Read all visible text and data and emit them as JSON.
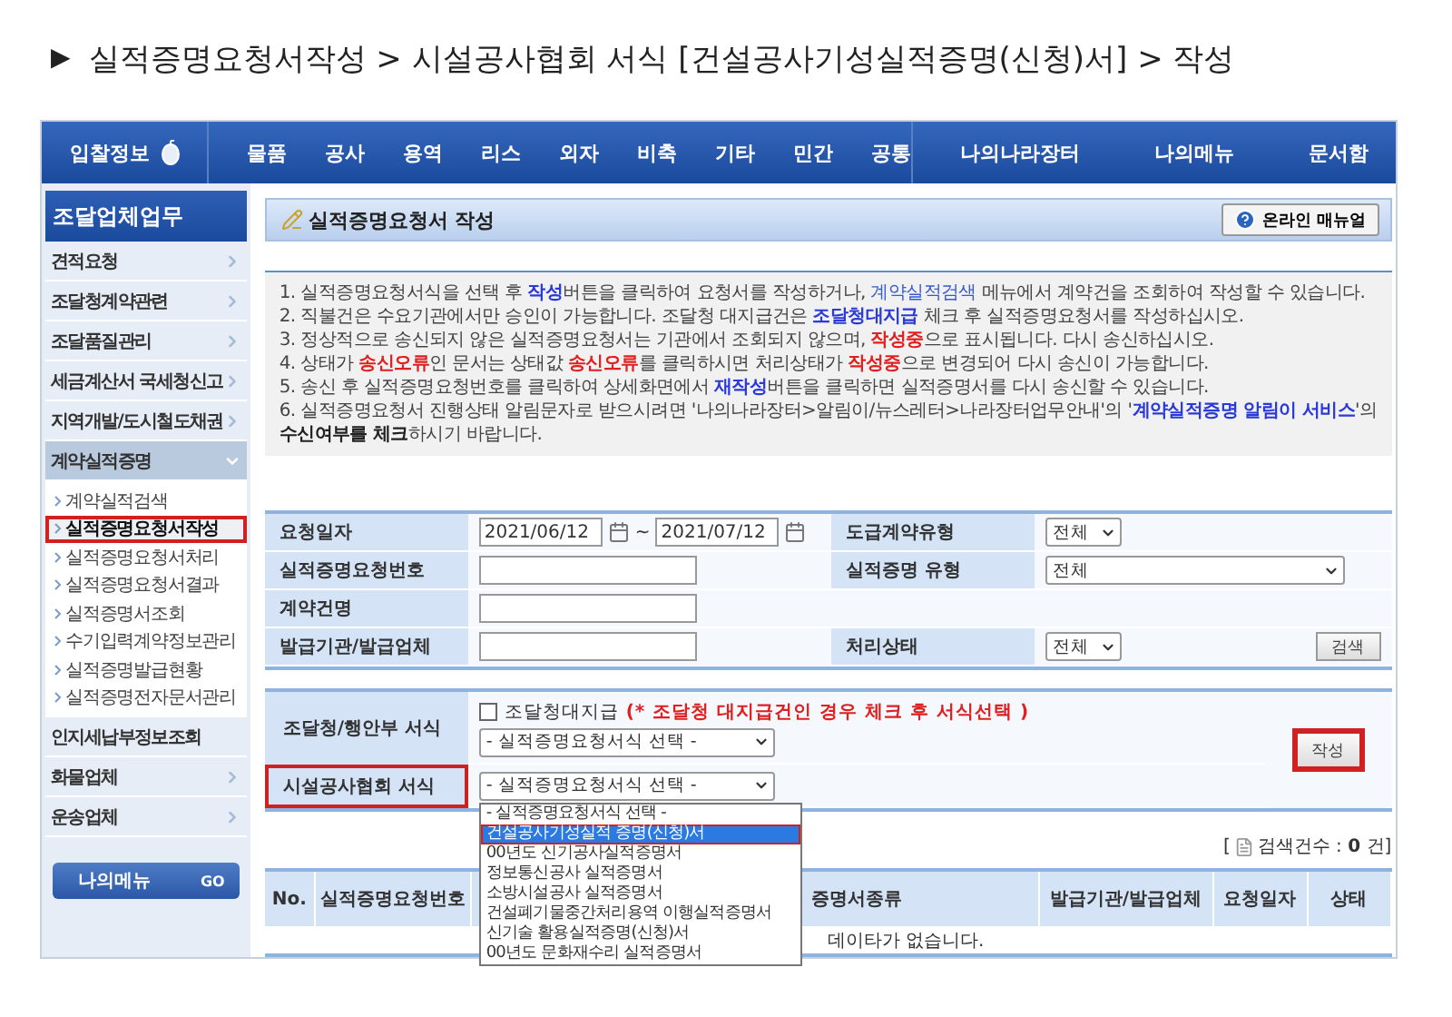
{
  "page_title": {
    "marker": "▶",
    "text": "실적증명요청서작성 > 시설공사협회 서식  [건설공사기성실적증명(신청)서] > 작성"
  },
  "nav": {
    "home": "입찰정보",
    "items": [
      "물품",
      "공사",
      "용역",
      "리스",
      "외자",
      "비축",
      "기타",
      "민간",
      "공통"
    ],
    "right_items": [
      "나의나라장터",
      "나의메뉴",
      "문서함"
    ]
  },
  "sidebar": {
    "header": "조달업체업무",
    "items": [
      {
        "label": "견적요청",
        "expandable": true,
        "expanded": false
      },
      {
        "label": "조달청계약관련",
        "expandable": true,
        "expanded": false
      },
      {
        "label": "조달품질관리",
        "expandable": true,
        "expanded": false
      },
      {
        "label": "세금계산서 국세청신고",
        "expandable": true,
        "expanded": false
      },
      {
        "label": "지역개발/도시철도채권",
        "expandable": true,
        "expanded": false
      },
      {
        "label": "계약실적증명",
        "expandable": true,
        "expanded": true,
        "children": [
          {
            "label": "계약실적검색",
            "selected": false,
            "highlighted": false
          },
          {
            "label": "실적증명요청서작성",
            "selected": true,
            "highlighted": true
          },
          {
            "label": "실적증명요청서처리",
            "selected": false,
            "highlighted": false
          },
          {
            "label": "실적증명요청서결과",
            "selected": false,
            "highlighted": false
          },
          {
            "label": "실적증명서조회",
            "selected": false,
            "highlighted": false
          },
          {
            "label": "수기입력계약정보관리",
            "selected": false,
            "highlighted": false
          },
          {
            "label": "실적증명발급현황",
            "selected": false,
            "highlighted": false
          },
          {
            "label": "실적증명전자문서관리",
            "selected": false,
            "highlighted": false
          }
        ]
      },
      {
        "label": "인지세납부정보조회",
        "expandable": false,
        "expanded": false
      },
      {
        "label": "화물업체",
        "expandable": true,
        "expanded": false
      },
      {
        "label": "운송업체",
        "expandable": true,
        "expanded": false
      }
    ],
    "my_menu": {
      "label": "나의메뉴",
      "go": "GO"
    }
  },
  "content": {
    "title": "실적증명요청서 작성",
    "manual_button": "온라인 매뉴얼",
    "instructions": [
      [
        {
          "bold": false,
          "color": "#444444",
          "text": "1. 실적증명요청서식을 선택 후 "
        },
        {
          "bold": true,
          "color": "#2a3ad8",
          "text": "작성"
        },
        {
          "bold": false,
          "color": "#444444",
          "text": "버튼을 클릭하여 요청서를 작성하거나, "
        },
        {
          "bold": false,
          "color": "#3a5ad0",
          "text": "계약실적검색"
        },
        {
          "bold": false,
          "color": "#444444",
          "text": " 메뉴에서 계약건을 조회하여 작성할 수 있습니다."
        }
      ],
      [
        {
          "bold": false,
          "color": "#444444",
          "text": "2. 직불건은 수요기관에서만 승인이 가능합니다. 조달청 대지급건은 "
        },
        {
          "bold": true,
          "color": "#2a3ad8",
          "text": "조달청대지급"
        },
        {
          "bold": false,
          "color": "#444444",
          "text": " 체크 후 실적증명요청서를 작성하십시오."
        }
      ],
      [
        {
          "bold": false,
          "color": "#444444",
          "text": "3. 정상적으로 송신되지 않은 실적증명요청서는 기관에서 조회되지 않으며, "
        },
        {
          "bold": true,
          "color": "#e02020",
          "text": "작성중"
        },
        {
          "bold": false,
          "color": "#444444",
          "text": "으로 표시됩니다. 다시 송신하십시오."
        }
      ],
      [
        {
          "bold": false,
          "color": "#444444",
          "text": "4. 상태가 "
        },
        {
          "bold": true,
          "color": "#e02020",
          "text": "송신오류"
        },
        {
          "bold": false,
          "color": "#444444",
          "text": "인 문서는 상태값 "
        },
        {
          "bold": true,
          "color": "#e02020",
          "text": "송신오류"
        },
        {
          "bold": false,
          "color": "#444444",
          "text": "를 클릭하시면 처리상태가 "
        },
        {
          "bold": true,
          "color": "#e02020",
          "text": "작성중"
        },
        {
          "bold": false,
          "color": "#444444",
          "text": "으로 변경되어 다시 송신이 가능합니다."
        }
      ],
      [
        {
          "bold": false,
          "color": "#444444",
          "text": "5. 송신 후 실적증명요청번호를 클릭하여 상세화면에서 "
        },
        {
          "bold": true,
          "color": "#2a3ad8",
          "text": "재작성"
        },
        {
          "bold": false,
          "color": "#444444",
          "text": "버튼을 클릭하면 실적증명서를 다시 송신할 수 있습니다."
        }
      ],
      [
        {
          "bold": false,
          "color": "#444444",
          "text": "6. 실적증명요청서 진행상태 알림문자로 받으시려면 '나의나라장터>알림이/뉴스레터>나라장터업무안내'의 '"
        },
        {
          "bold": true,
          "color": "#2a3ad8",
          "text": "계약실적증명 알림이 서비스"
        },
        {
          "bold": false,
          "color": "#444444",
          "text": "'의"
        }
      ],
      [
        {
          "bold": true,
          "color": "#222222",
          "text": "수신여부를 체크"
        },
        {
          "bold": false,
          "color": "#444444",
          "text": "하시기 바랍니다."
        }
      ]
    ],
    "search_form": {
      "rows": [
        [
          {
            "kind": "label",
            "text": "요청일자"
          },
          {
            "kind": "date_range",
            "from": "2021/06/12",
            "separator": "~",
            "to": "2021/07/12"
          },
          {
            "kind": "label",
            "text": "도급계약유형"
          },
          {
            "kind": "select",
            "value": "전체"
          }
        ],
        [
          {
            "kind": "label",
            "text": "실적증명요청번호"
          },
          {
            "kind": "input"
          },
          {
            "kind": "label",
            "text": "실적증명 유형"
          },
          {
            "kind": "select_wide",
            "value": "전체"
          }
        ],
        [
          {
            "kind": "label",
            "text": "계약건명"
          },
          {
            "kind": "input"
          },
          {
            "kind": "blank"
          },
          {
            "kind": "blank"
          }
        ],
        [
          {
            "kind": "label",
            "text": "발급기관/발급업체"
          },
          {
            "kind": "input"
          },
          {
            "kind": "label",
            "text": "처리상태"
          },
          {
            "kind": "select",
            "value": "전체",
            "button": "검색"
          }
        ]
      ]
    },
    "form_select": {
      "pps": {
        "label": "조달청/행안부 서식",
        "highlighted": false,
        "checkbox": {
          "label": "조달청대지급",
          "checked": false
        },
        "note": "(* 조달청 대지급건인 경우 체크 후 서식선택 )",
        "select": "- 실적증명요청서식 선택 -"
      },
      "association": {
        "label": "시설공사협회 서식",
        "highlighted": true,
        "select": "- 실적증명요청서식 선택 -",
        "open": true,
        "options": [
          {
            "text": "- 실적증명요청서식 선택 -",
            "selected": false,
            "highlighted": false
          },
          {
            "text": "건설공사기성실적 증명(신청)서",
            "selected": true,
            "highlighted": true
          },
          {
            "text": "00년도 신기공사실적증명서",
            "selected": false,
            "highlighted": false
          },
          {
            "text": "정보통신공사 실적증명서",
            "selected": false,
            "highlighted": false
          },
          {
            "text": "소방시설공사 실적증명서",
            "selected": false,
            "highlighted": false
          },
          {
            "text": "건설폐기물중간처리용역 이행실적증명서",
            "selected": false,
            "highlighted": false
          },
          {
            "text": "신기술 활용실적증명(신청)서",
            "selected": false,
            "highlighted": false
          },
          {
            "text": "00년도 문화재수리 실적증명서",
            "selected": false,
            "highlighted": false
          }
        ]
      },
      "write_button": {
        "label": "작성",
        "highlighted": true
      }
    },
    "result_count": {
      "open": "[",
      "text": "검색건수 : **0** 건]"
    },
    "table": {
      "columns": [
        "No.",
        "실적증명요청번호",
        null,
        "증명서종류",
        "발급기관/발급업체",
        "요청일자",
        "상태"
      ],
      "empty_message": "데이타가 없습니다."
    }
  }
}
